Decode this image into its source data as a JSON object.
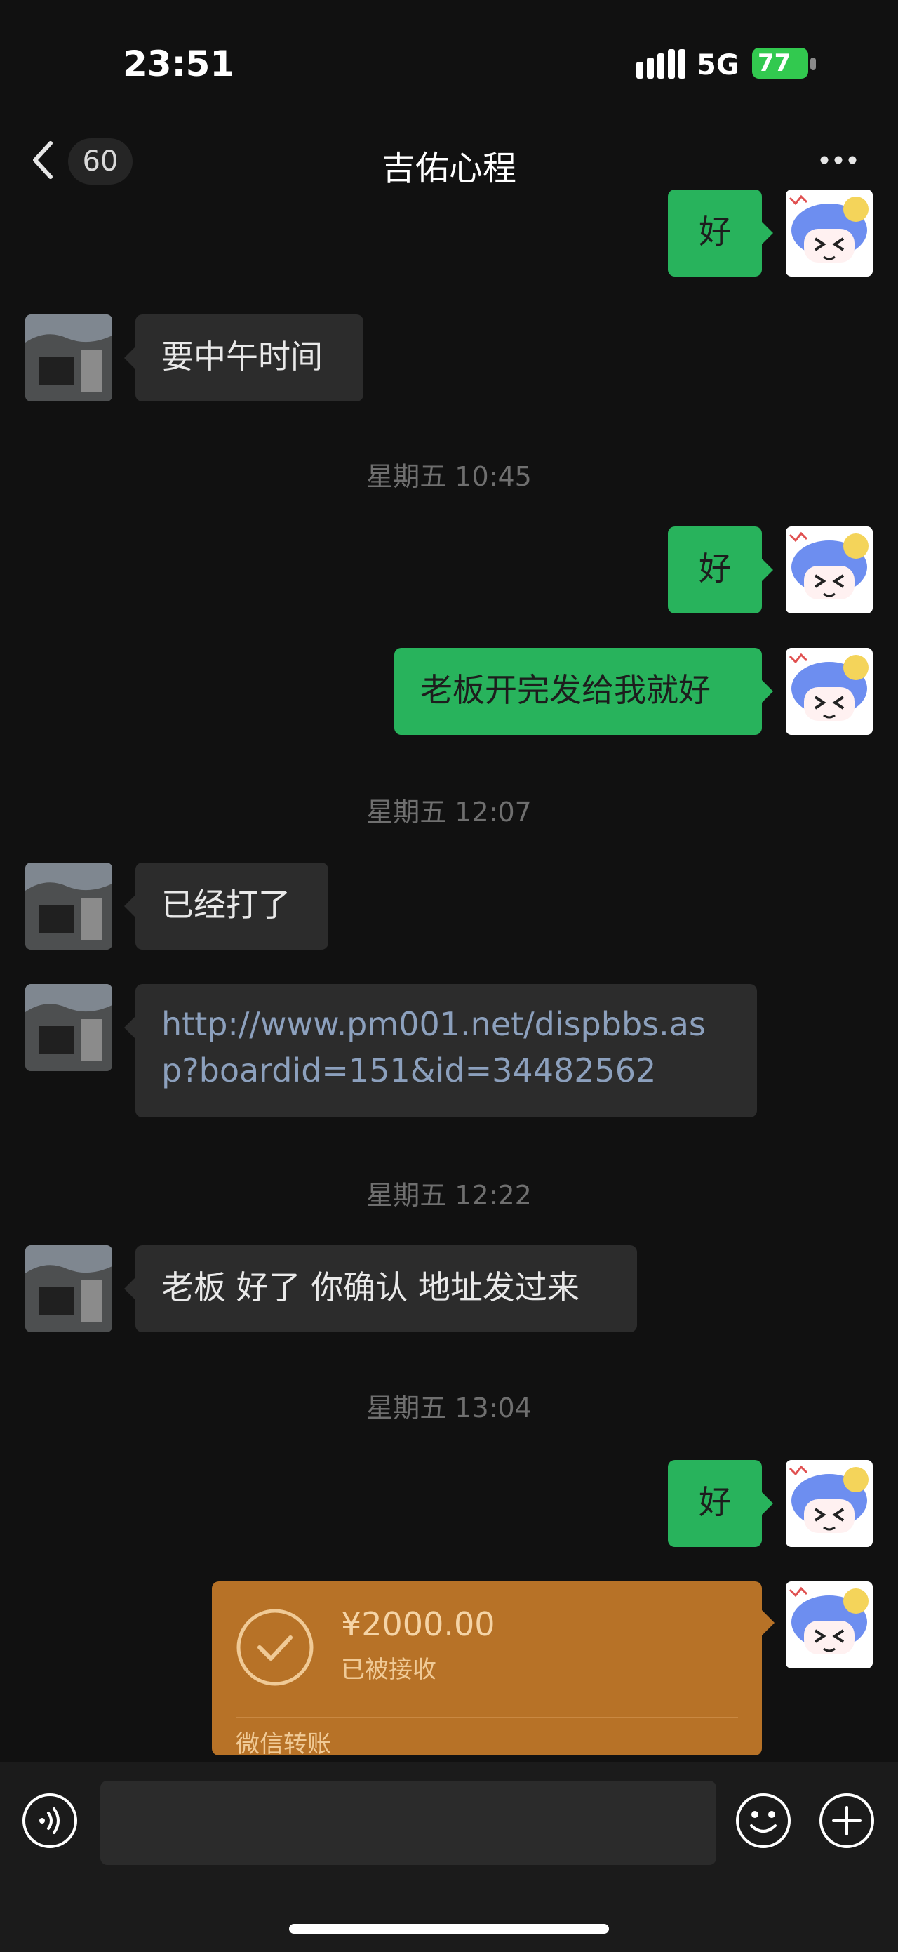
{
  "status_bar": {
    "time": "23:51",
    "network": "5G",
    "battery": "77"
  },
  "header": {
    "back_count": "60",
    "title": "吉佑心程",
    "more_icon": "ellipsis-icon"
  },
  "messages": [
    {
      "side": "right",
      "text": "好"
    },
    {
      "side": "left",
      "text": "要中午时间"
    },
    {
      "type": "time",
      "text": "星期五 10:45"
    },
    {
      "side": "right",
      "text": "好"
    },
    {
      "side": "right",
      "text": "老板开完发给我就好"
    },
    {
      "type": "time",
      "text": "星期五 12:07"
    },
    {
      "side": "left",
      "text": "已经打了"
    },
    {
      "side": "left",
      "text": "http://www.pm001.net/dispbbs.asp?boardid=151&id=34482562"
    },
    {
      "type": "time",
      "text": "星期五 12:22"
    },
    {
      "side": "left",
      "text": "老板 好了 你确认 地址发过来"
    },
    {
      "type": "time",
      "text": "星期五 13:04"
    },
    {
      "side": "right",
      "text": "好"
    }
  ],
  "transfer": {
    "amount": "¥2000.00",
    "status": "已被接收",
    "label": "微信转账",
    "icon": "check-circle-icon"
  },
  "composer": {
    "voice_icon": "voice-icon",
    "emoji_icon": "smile-icon",
    "plus_icon": "plus-icon",
    "input_value": ""
  },
  "colors": {
    "background": "#111111",
    "bubble_left": "#2c2c2c",
    "bubble_right": "#28b35c",
    "transfer": "#b77227",
    "link": "#8ca0bd",
    "timestamp": "#6f6f6f"
  }
}
